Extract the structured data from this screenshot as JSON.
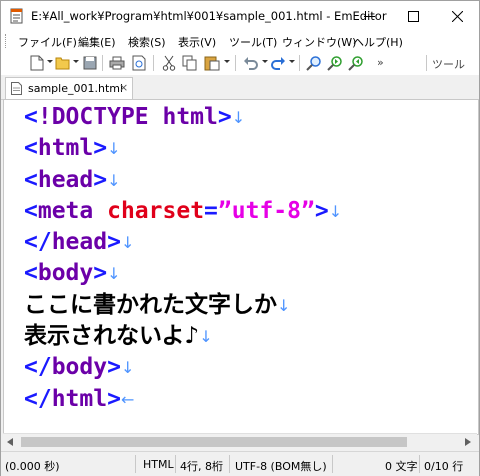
{
  "window": {
    "title": "E:¥All_work¥Program¥html¥001¥sample_001.html - EmEditor"
  },
  "menu": [
    {
      "label": "ファイル(F)"
    },
    {
      "label": "編集(E)"
    },
    {
      "label": "検索(S)"
    },
    {
      "label": "表示(V)"
    },
    {
      "label": "ツール(T)"
    },
    {
      "label": "ウィンドウ(W)"
    },
    {
      "label": "ヘルプ(H)"
    }
  ],
  "toolbar": {
    "icons": [
      "new-file-icon",
      "open-file-icon",
      "save-icon",
      "print-icon",
      "print-preview-icon",
      "cut-icon",
      "copy-icon",
      "paste-icon",
      "undo-icon",
      "redo-icon",
      "find-icon",
      "find-next-icon",
      "find-prev-icon"
    ],
    "tools_label": "ツール"
  },
  "tab": {
    "label": "sample_001.html",
    "close_symbol": "×"
  },
  "editor": {
    "eol_symbol": "↓",
    "eof_symbol": "←",
    "lines": {
      "l1": {
        "open": "<",
        "name": "!DOCTYPE html",
        "close": ">"
      },
      "l2": {
        "open": "<",
        "name": "html",
        "close": ">"
      },
      "l3": {
        "open": "<",
        "name": "head",
        "close": ">"
      },
      "l4": {
        "open": "<",
        "name": "meta",
        "sp": " ",
        "attr": "charset",
        "eq": "=",
        "value": "”utf-8”",
        "close": ">"
      },
      "l5": {
        "open": "</",
        "name": "head",
        "close": ">"
      },
      "l6": {
        "open": "<",
        "name": "body",
        "close": ">"
      },
      "l7": {
        "text": "ここに書かれた文字しか"
      },
      "l8": {
        "text": "表示されないよ♪"
      },
      "l9": {
        "open": "</",
        "name": "body",
        "close": ">"
      },
      "l10": {
        "open": "</",
        "name": "html",
        "close": ">"
      }
    }
  },
  "status": {
    "time": "(0.000 秒)",
    "mode": "HTML",
    "position": "4行, 8桁",
    "encoding": "UTF-8 (BOM無し)",
    "chars": "0 文字",
    "lines": "0/10 行"
  }
}
